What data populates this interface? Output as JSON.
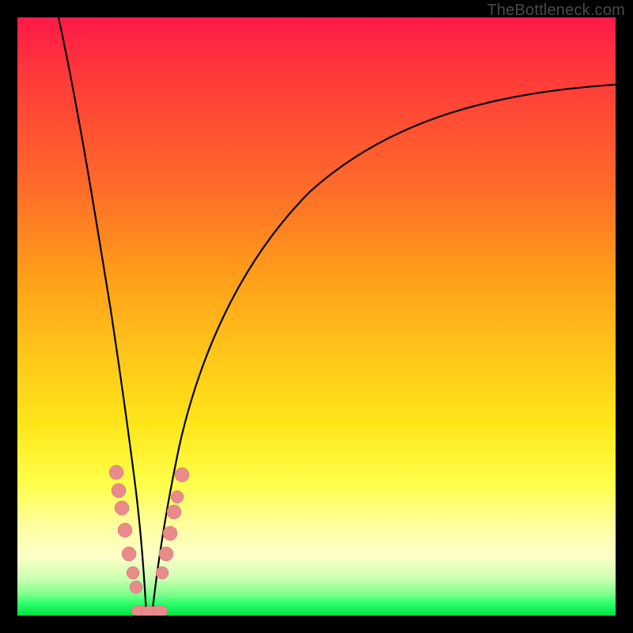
{
  "watermark": "TheBottleneck.com",
  "colors": {
    "dot": "#e98b8b",
    "curve": "#000000"
  },
  "chart_data": {
    "type": "line",
    "title": "",
    "xlabel": "",
    "ylabel": "",
    "xlim": [
      0,
      100
    ],
    "ylim": [
      0,
      100
    ],
    "notes": "Two curves forming a V near x≈20; y≈bottleneck%, 0 at bottom (green) → 100 at top (red). No axis ticks shown.",
    "series": [
      {
        "name": "left-branch",
        "x": [
          7,
          10,
          13,
          15,
          17,
          18,
          19,
          20
        ],
        "values": [
          100,
          80,
          55,
          40,
          25,
          15,
          6,
          0
        ]
      },
      {
        "name": "right-branch",
        "x": [
          20,
          22,
          24,
          27,
          32,
          40,
          55,
          75,
          100
        ],
        "values": [
          0,
          8,
          18,
          32,
          48,
          63,
          76,
          84,
          88
        ]
      }
    ],
    "markers_left": [
      {
        "x": 16.5,
        "y": 24
      },
      {
        "x": 16.8,
        "y": 21
      },
      {
        "x": 17.2,
        "y": 18
      },
      {
        "x": 17.6,
        "y": 14
      },
      {
        "x": 18.2,
        "y": 10
      },
      {
        "x": 18.7,
        "y": 7
      },
      {
        "x": 19.1,
        "y": 5
      }
    ],
    "markers_right": [
      {
        "x": 22.0,
        "y": 7
      },
      {
        "x": 22.6,
        "y": 11
      },
      {
        "x": 23.2,
        "y": 14
      },
      {
        "x": 23.8,
        "y": 18
      },
      {
        "x": 24.2,
        "y": 20
      },
      {
        "x": 24.8,
        "y": 24
      }
    ],
    "markers_bottom": [
      {
        "x": 19.4,
        "y": 0.5
      },
      {
        "x": 20.3,
        "y": 0.5
      },
      {
        "x": 21.2,
        "y": 0.5
      }
    ]
  }
}
